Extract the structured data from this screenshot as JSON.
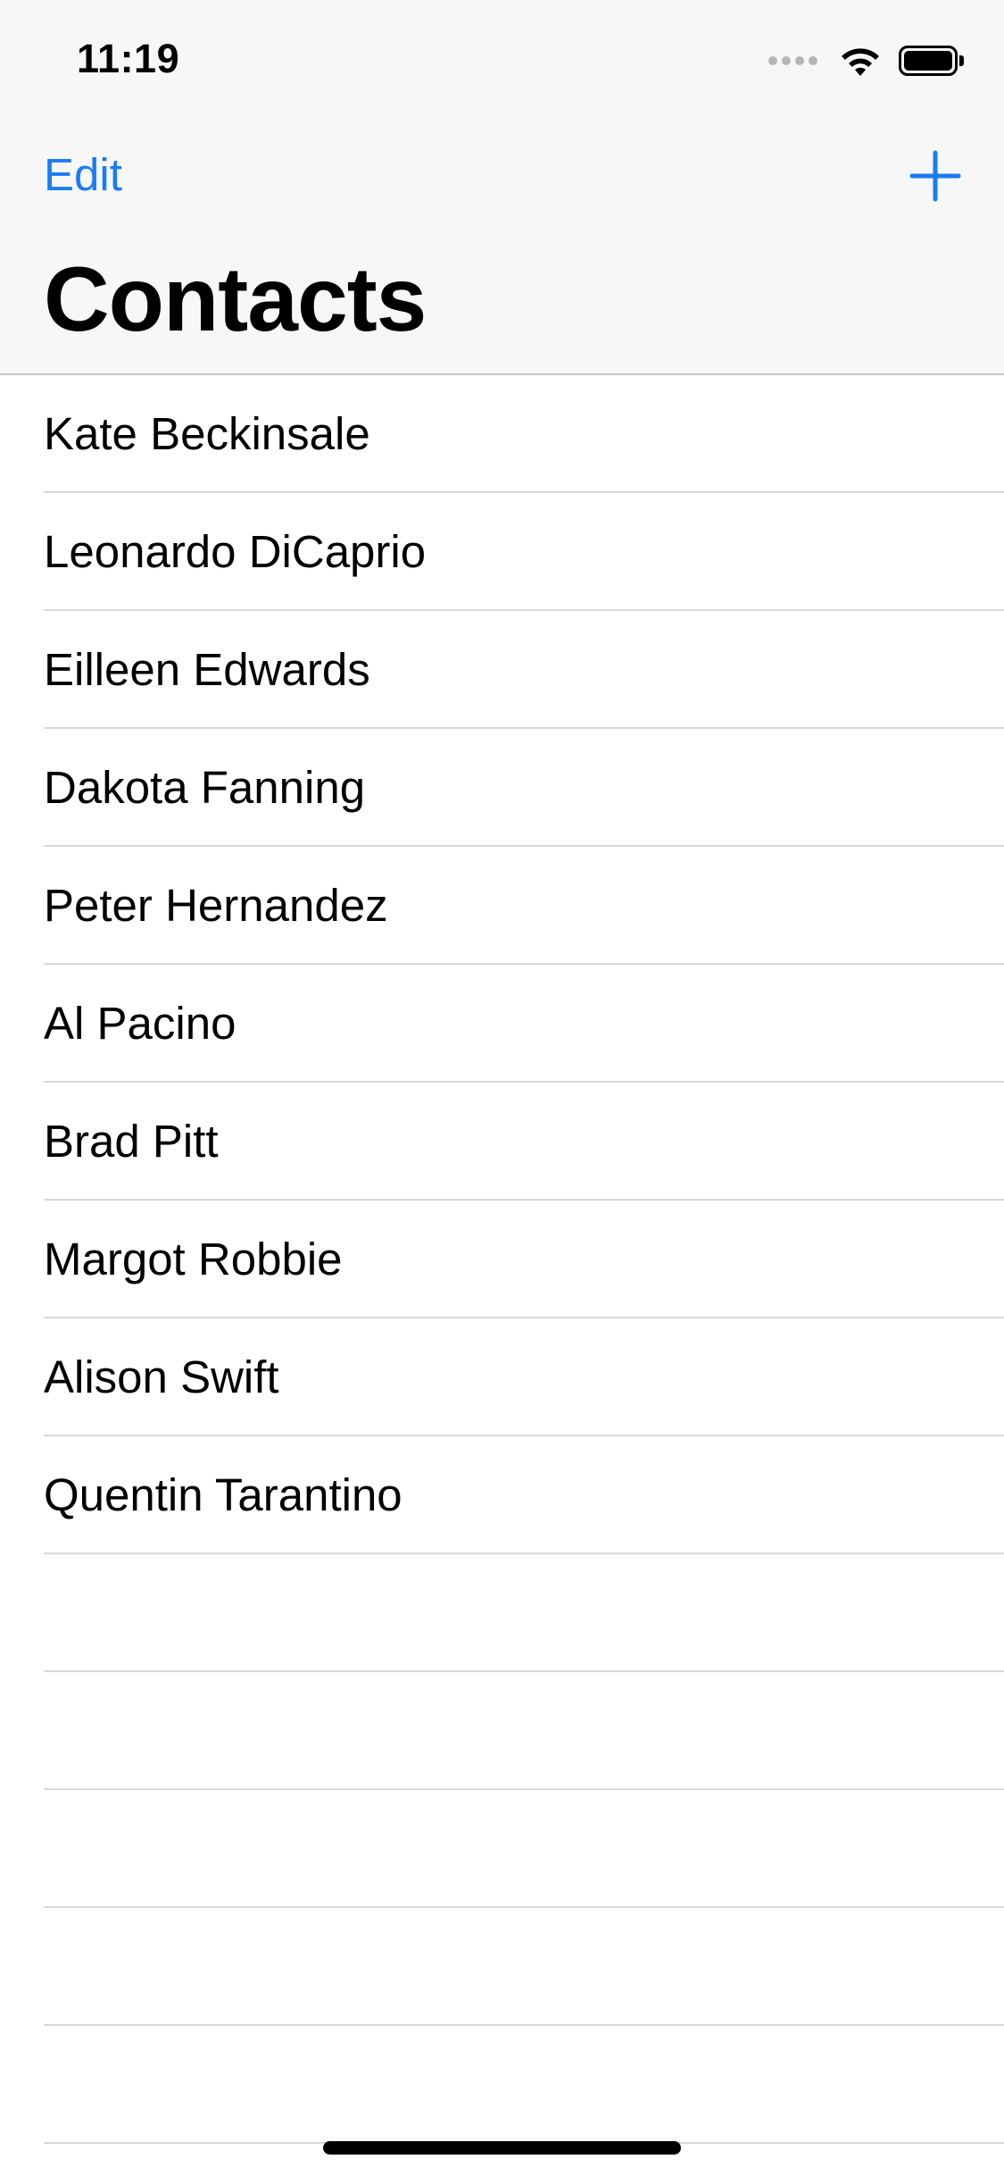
{
  "status_bar": {
    "time": "11:19"
  },
  "nav": {
    "edit_label": "Edit",
    "add_icon": "plus-icon",
    "title": "Contacts"
  },
  "contacts": [
    "Kate Beckinsale",
    "Leonardo DiCaprio",
    "Eilleen Edwards",
    "Dakota Fanning",
    "Peter Hernandez",
    "Al Pacino",
    "Brad Pitt",
    "Margot Robbie",
    "Alison Swift",
    "Quentin Tarantino"
  ],
  "colors": {
    "accent": "#1a7cf5",
    "header_bg": "#f7f7f7",
    "separator": "#d8d8dc"
  }
}
